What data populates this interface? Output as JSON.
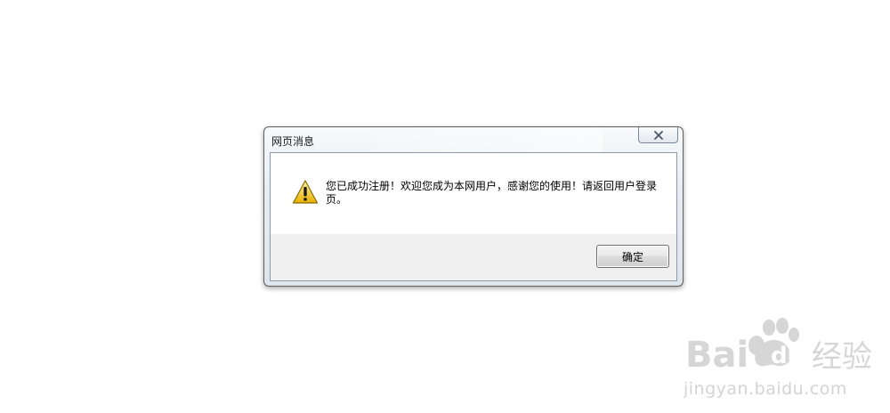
{
  "dialog": {
    "title": "网页消息",
    "message": "您已成功注册！欢迎您成为本网用户，感谢您的使用！请返回用户登录页。",
    "ok_label": "确定",
    "icons": {
      "close": "close-icon",
      "warning": "warning-icon"
    }
  },
  "watermark": {
    "brand": "Bai du 经验",
    "url": "jingyan.baidu.com"
  },
  "colors": {
    "warning_yellow": "#f2c200",
    "watermark_gray": "#d4d4d4"
  }
}
